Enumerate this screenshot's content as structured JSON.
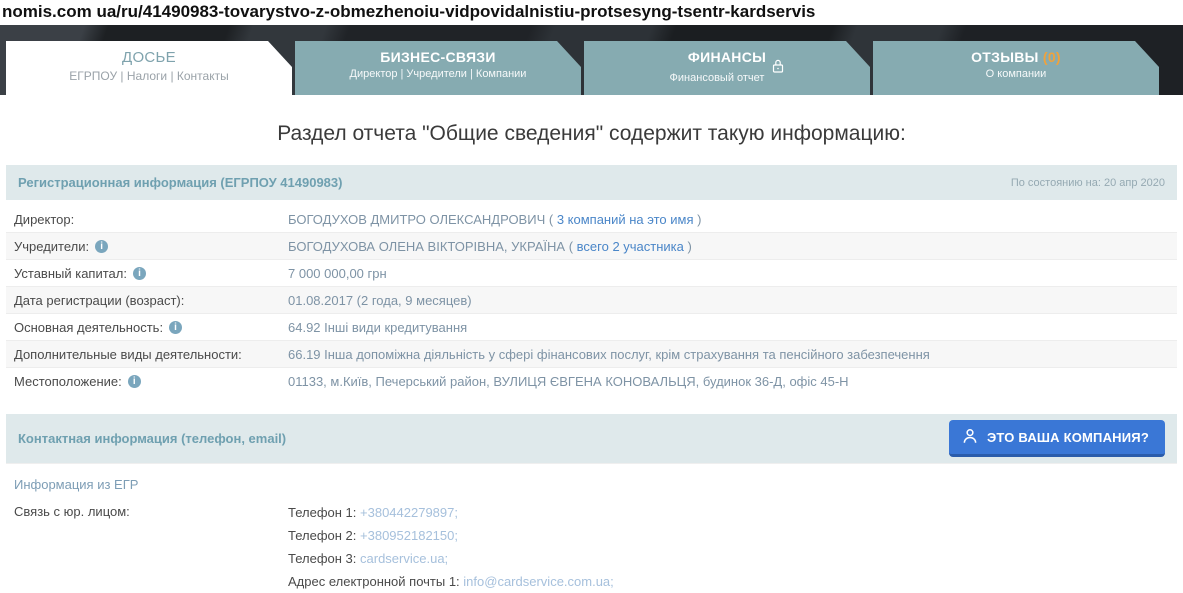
{
  "url": "nomis.com ua/ru/41490983-tovarystvo-z-obmezhenoiu-vidpovidalnistiu-protsesyng-tsentr-kardservis",
  "colors": {
    "tab_teal": "#86abb1",
    "link_blue": "#4a86c8",
    "pale_link_blue": "#a6c0dc",
    "button_blue": "#3a77d6",
    "badge_orange": "#f0a23c",
    "section_bar_bg": "#dfe9eb"
  },
  "tabs": [
    {
      "title": "ДОСЬЕ",
      "subtitle": "ЕГРПОУ | Налоги | Контакты",
      "active": true
    },
    {
      "title": "БИЗНЕС-СВЯЗИ",
      "subtitle": "Директор | Учредители | Компании",
      "active": false
    },
    {
      "title": "ФИНАНСЫ",
      "subtitle": "Финансовый отчет",
      "active": false,
      "lock_icon": "lock-icon"
    },
    {
      "title": "ОТЗЫВЫ",
      "badge": "(0)",
      "subtitle": "О компании",
      "active": false
    }
  ],
  "heading": "Раздел отчета \"Общие сведения\" содержит такую информацию:",
  "registration": {
    "title": "Регистрационная информация (ЕГРПОУ 41490983)",
    "as_of": "По состоянию на: 20 апр 2020",
    "rows": [
      {
        "label": "Директор:",
        "value": "БОГОДУХОВ ДМИТРО ОЛЕКСАНДРОВИЧ (",
        "link": "3 компаний на это имя",
        "suffix": ")"
      },
      {
        "label": "Учредители:",
        "info": true,
        "value": "БОГОДУХОВА ОЛЕНА ВІКТОРІВНА, УКРАЇНА (",
        "link": "всего 2 участника",
        "suffix": ")"
      },
      {
        "label": "Уставный капитал:",
        "info": true,
        "value": "7 000 000,00 грн"
      },
      {
        "label": "Дата регистрации (возраст):",
        "value": "01.08.2017 (2 года, 9 месяцев)"
      },
      {
        "label": "Основная деятельность:",
        "info": true,
        "value": "64.92 Інші види кредитування"
      },
      {
        "label": "Дополнительные виды деятельности:",
        "value": "66.19 Інша допоміжна діяльність у сфері фінансових послуг, крім страхування та пенсійного забезпечення"
      },
      {
        "label": "Местоположение:",
        "info": true,
        "value": "01133, м.Київ, Печерський район, ВУЛИЦЯ ЄВГЕНА КОНОВАЛЬЦЯ, будинок 36-Д, офіс 45-Н"
      }
    ]
  },
  "contact": {
    "title": "Контактная информация (телефон, email)",
    "button_label": "ЭТО ВАША КОМПАНИЯ?",
    "source_label": "Информация из ЕГР",
    "entity_label": "Связь с юр. лицом:",
    "lines": [
      {
        "label": "Телефон 1:",
        "value": "+380442279897;"
      },
      {
        "label": "Телефон 2:",
        "value": "+380952182150;"
      },
      {
        "label": "Телефон 3:",
        "value": "cardservice.ua;"
      },
      {
        "label": "Адрес електронной почты 1:",
        "value": "info@cardservice.com.ua;"
      }
    ]
  }
}
